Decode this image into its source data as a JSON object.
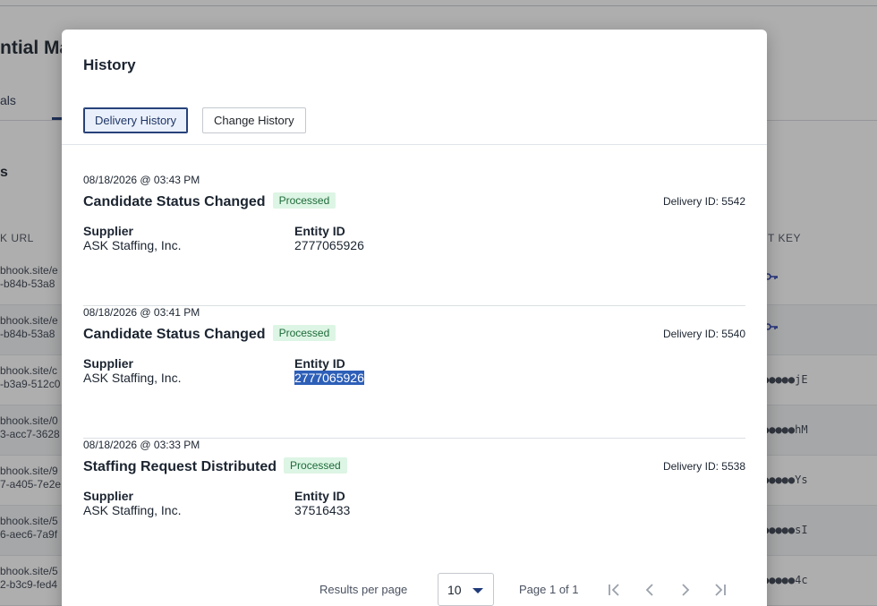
{
  "background": {
    "title_fragment": "ntial Ma",
    "tab_fragment": "als",
    "section_fragment": "s",
    "col_url": "K URL",
    "col_key": "T KEY",
    "rows": [
      {
        "url1": "bhook.site/e",
        "url2": "-b84b-53a8",
        "secret": ""
      },
      {
        "url1": "bhook.site/e",
        "url2": "-b84b-53a8",
        "secret": ""
      },
      {
        "url1": "bhook.site/c",
        "url2": "-b3a9-512c0",
        "secret": "●●●●●jE"
      },
      {
        "url1": "bhook.site/0",
        "url2": "3-acc7-3628",
        "secret": "●●●●●hM"
      },
      {
        "url1": "bhook.site/9",
        "url2": "7-a405-7e2e",
        "secret": "●●●●●Ys"
      },
      {
        "url1": "bhook.site/5",
        "url2": "6-aec6-7a9f",
        "secret": "●●●●●sI"
      },
      {
        "url1": "bhook.site/5",
        "url2": "2-b3c9-fed4",
        "secret": "●●●●●4c"
      }
    ]
  },
  "modal": {
    "title": "History",
    "tabs": [
      {
        "label": "Delivery History",
        "active": true
      },
      {
        "label": "Change History",
        "active": false
      }
    ],
    "entries": [
      {
        "date": "08/18/2026 @ 03:43 PM",
        "event": "Candidate Status Changed",
        "status": "Processed",
        "delivery_id": "Delivery ID: 5542",
        "supplier_label": "Supplier",
        "supplier": "ASK Staffing, Inc.",
        "entity_label": "Entity ID",
        "entity_id": "2777065926"
      },
      {
        "date": "08/18/2026 @ 03:41 PM",
        "event": "Candidate Status Changed",
        "status": "Processed",
        "delivery_id": "Delivery ID: 5540",
        "supplier_label": "Supplier",
        "supplier": "ASK Staffing, Inc.",
        "entity_label": "Entity ID",
        "entity_id": "2777065926"
      },
      {
        "date": "08/18/2026 @ 03:33 PM",
        "event": "Staffing Request Distributed",
        "status": "Processed",
        "delivery_id": "Delivery ID: 5538",
        "supplier_label": "Supplier",
        "supplier": "ASK Staffing, Inc.",
        "entity_label": "Entity ID",
        "entity_id": "37516433"
      }
    ],
    "pagination": {
      "results_label": "Results per page",
      "per_page": "10",
      "page_info": "Page 1 of 1"
    }
  },
  "colors": {
    "accent": "#1f3a78",
    "badge_bg": "#ddf5e4",
    "badge_text": "#1e6b3a",
    "selection": "#2d5fb8"
  },
  "icons": [
    "key-icon",
    "caret-down-icon",
    "first-page-icon",
    "prev-page-icon",
    "next-page-icon",
    "last-page-icon"
  ]
}
